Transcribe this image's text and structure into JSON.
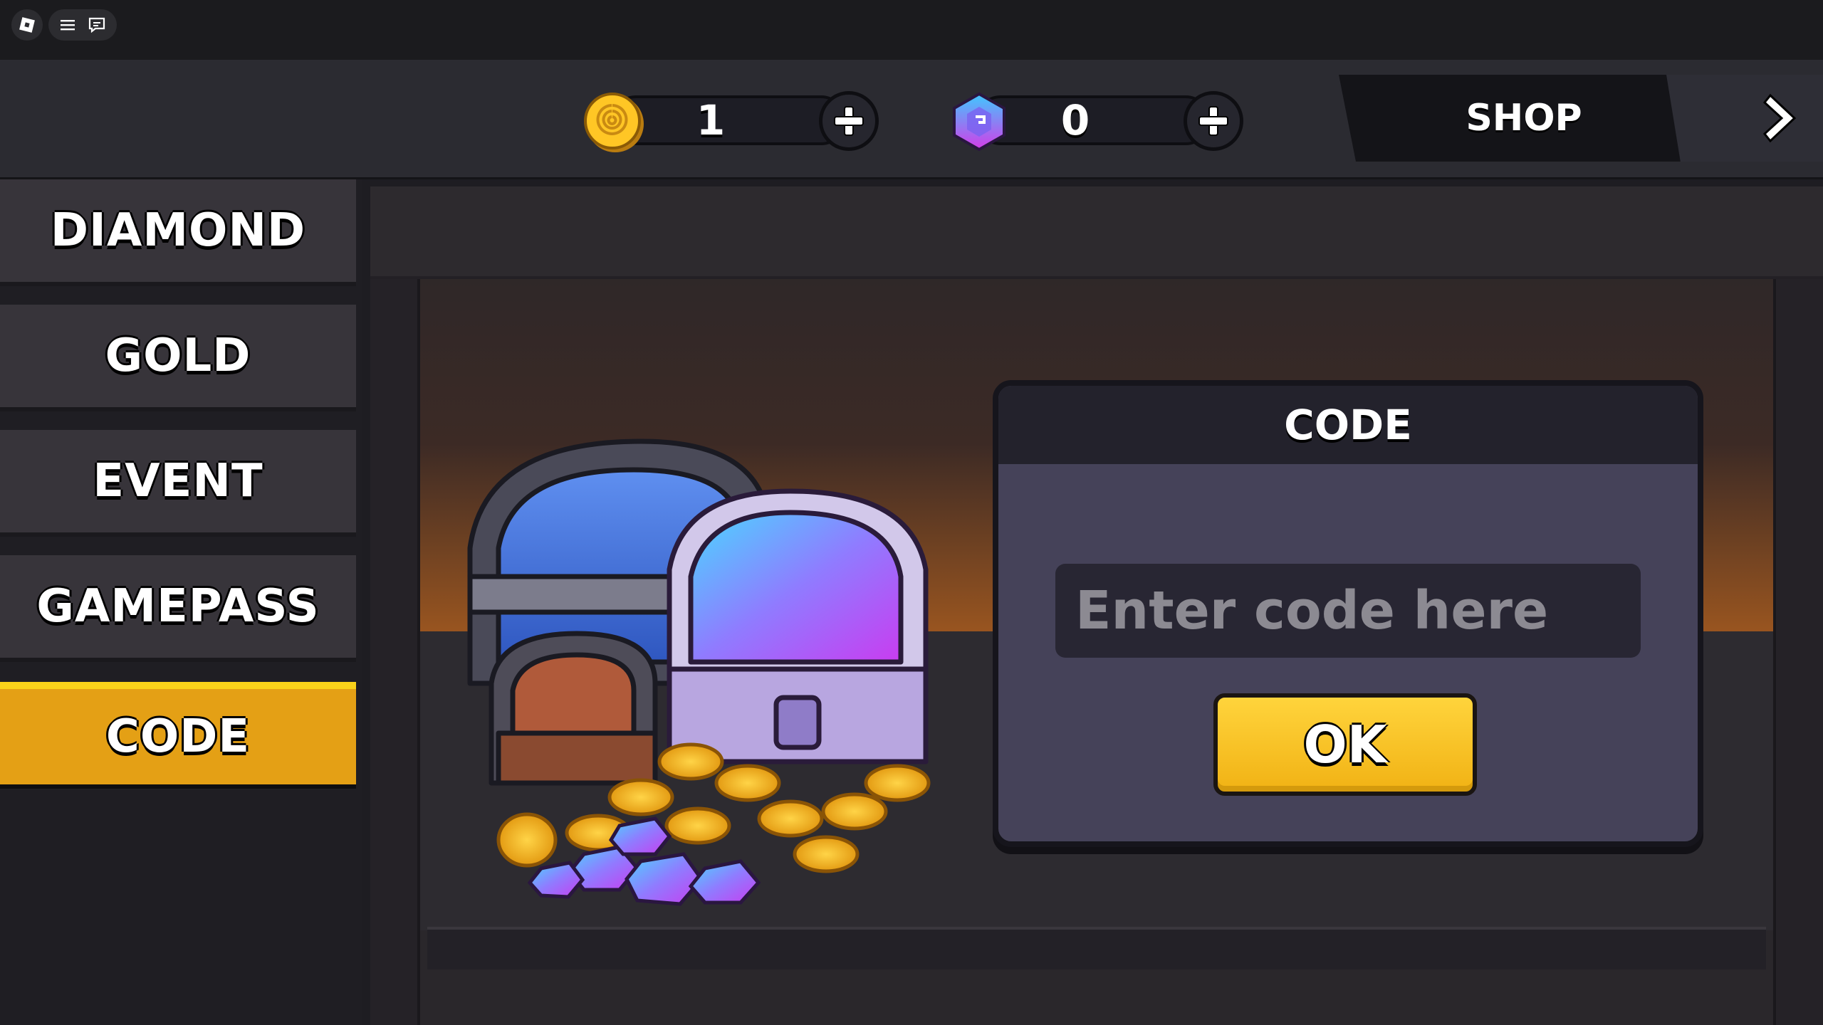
{
  "topbar": {
    "gold": {
      "value": "1",
      "icon": "gold-coin-icon"
    },
    "diamond": {
      "value": "0",
      "icon": "diamond-gem-icon"
    },
    "shop_label": "SHOP"
  },
  "sidebar": {
    "items": [
      {
        "label": "DIAMOND",
        "active": false
      },
      {
        "label": "GOLD",
        "active": false
      },
      {
        "label": "EVENT",
        "active": false
      },
      {
        "label": "GAMEPASS",
        "active": false
      },
      {
        "label": "CODE",
        "active": true
      }
    ]
  },
  "code_panel": {
    "title": "CODE",
    "input_placeholder": "Enter code here",
    "input_value": "",
    "ok_label": "OK"
  },
  "colors": {
    "active_tab": "#e4a015",
    "active_tab_top": "#f9d21a",
    "ok_button": "#f5c322",
    "panel": "#454259"
  }
}
